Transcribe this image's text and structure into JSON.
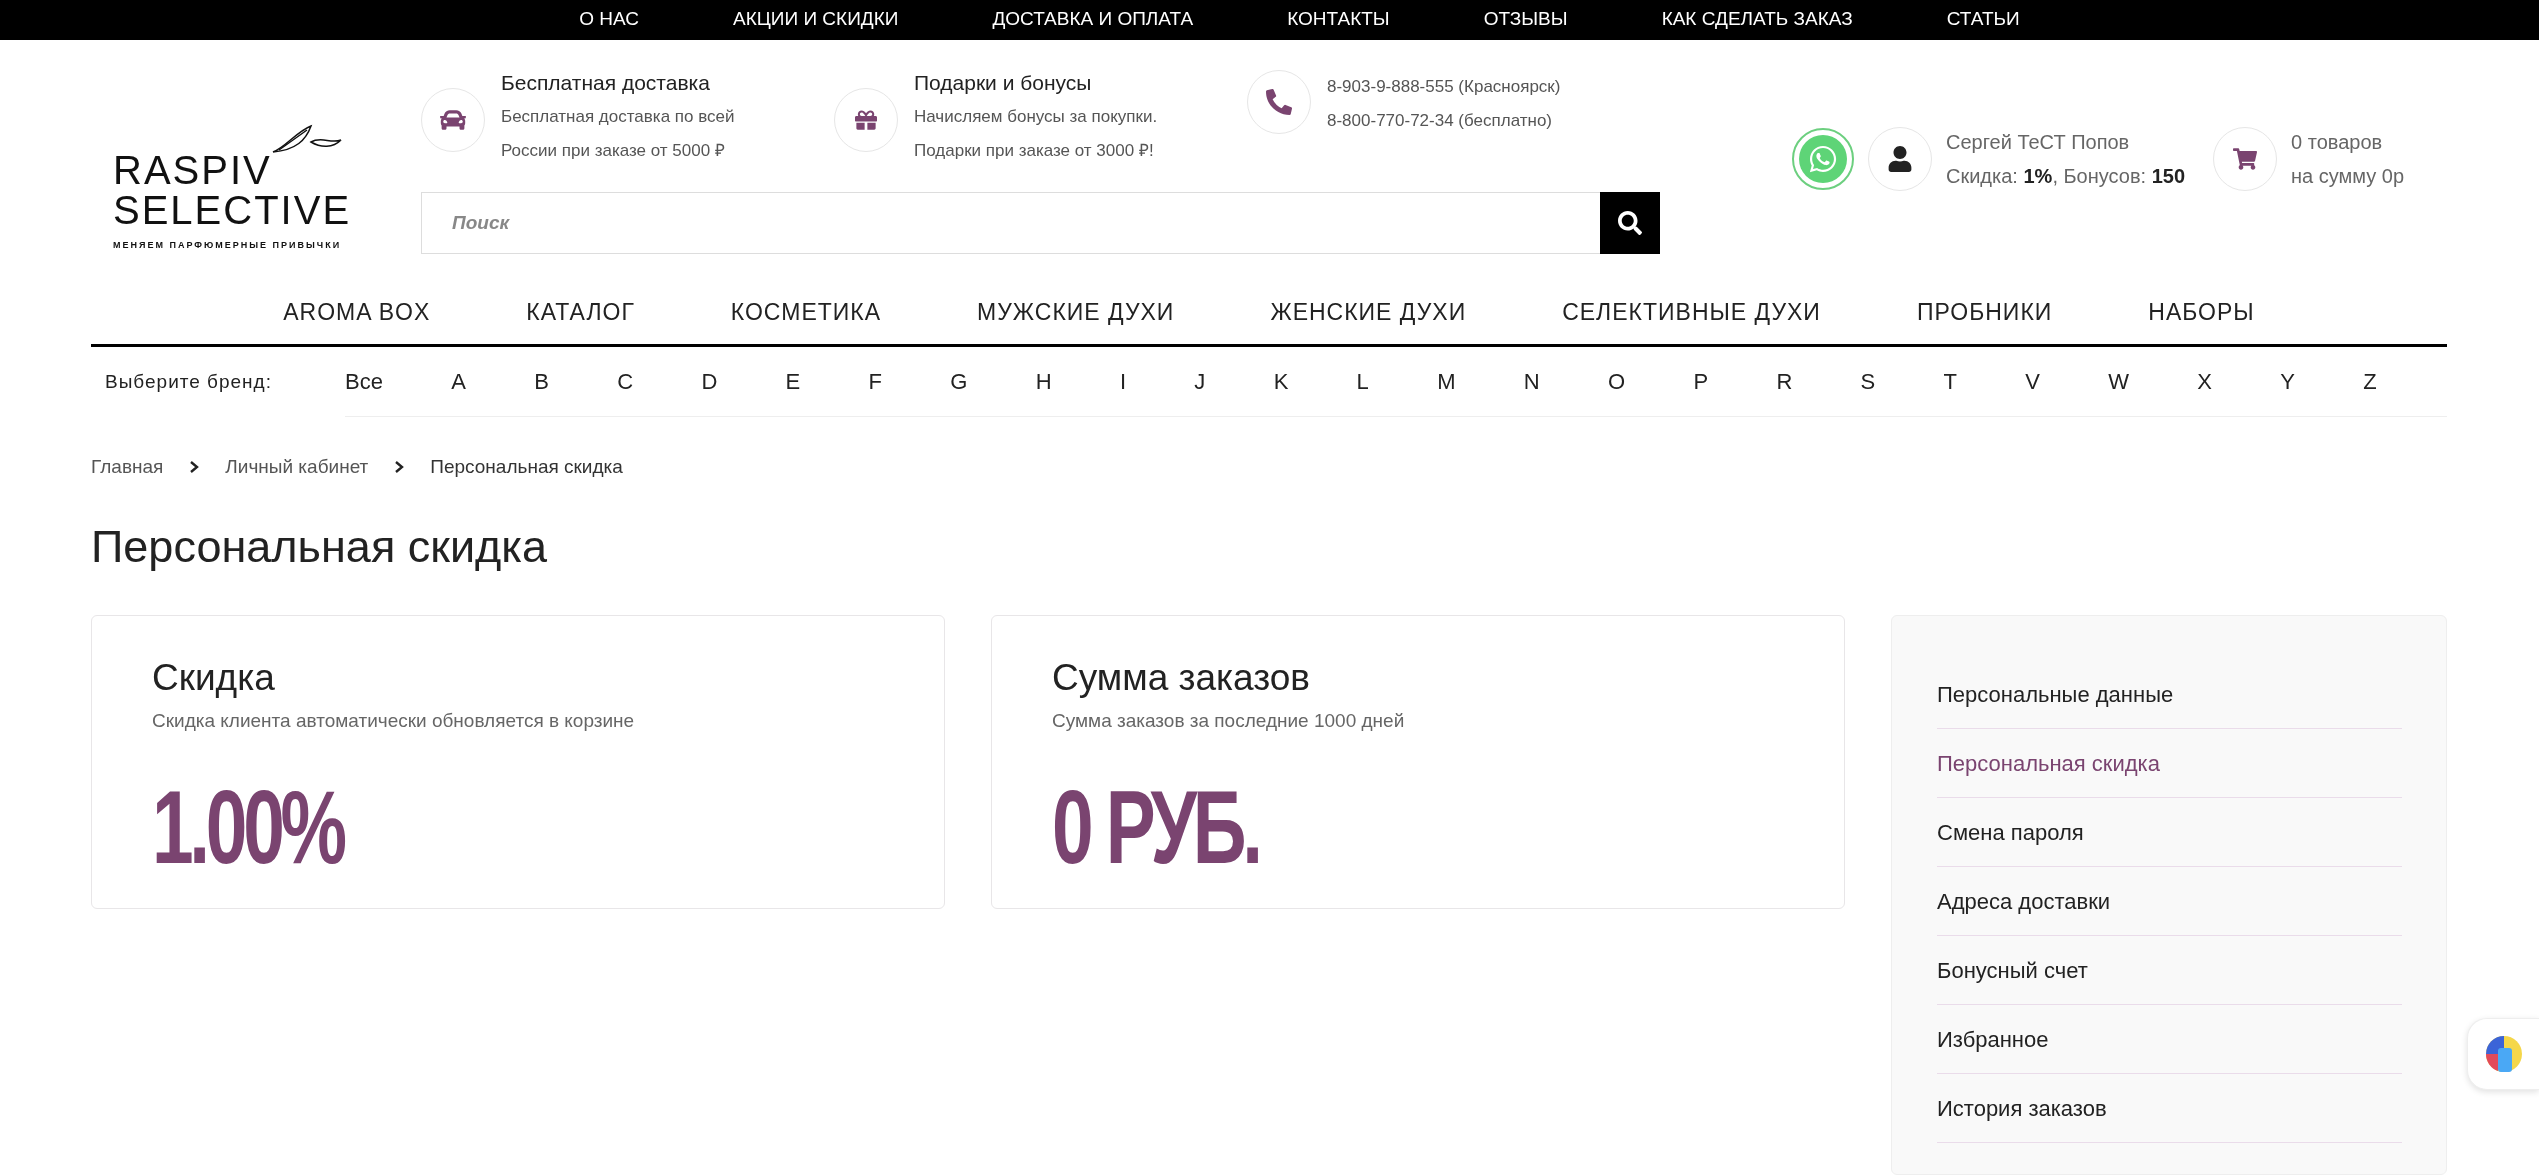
{
  "top_menu": [
    "О НАС",
    "АКЦИИ И СКИДКИ",
    "ДОСТАВКА И ОПЛАТА",
    "КОНТАКТЫ",
    "ОТЗЫВЫ",
    "КАК СДЕЛАТЬ ЗАКАЗ",
    "СТАТЬИ"
  ],
  "logo": {
    "line1": "RASPIV",
    "line2": "SELECTIVE",
    "tagline": "МЕНЯЕМ ПАРФЮМЕРНЫЕ ПРИВЫЧКИ"
  },
  "info_blocks": [
    {
      "kind": "delivery",
      "title": "Бесплатная доставка",
      "lines": [
        "Бесплатная доставка по всей",
        "России при заказе от 5000 ₽"
      ]
    },
    {
      "kind": "gift",
      "title": "Подарки и бонусы",
      "lines": [
        "Начисляем бонусы за покупки.",
        "Подарки при заказе от 3000 ₽!"
      ]
    },
    {
      "kind": "phone",
      "lines": [
        "8-903-9-888-555 (Красноярск)",
        "8-800-770-72-34 (бесплатно)"
      ]
    }
  ],
  "search": {
    "placeholder": "Поиск"
  },
  "user": {
    "name": "Сергей ТеСТ Попов",
    "status": "Скидка: **1%**, Бонусов: **150**"
  },
  "cart": {
    "lines": [
      "0 товаров",
      "на сумму 0р"
    ]
  },
  "main_nav": [
    "AROMA BOX",
    "КАТАЛОГ",
    "КОСМЕТИКА",
    "МУЖСКИЕ ДУХИ",
    "ЖЕНСКИЕ ДУХИ",
    "СЕЛЕКТИВНЫЕ ДУХИ",
    "ПРОБНИКИ",
    "НАБОРЫ"
  ],
  "brand_filter": {
    "label": "Выберите бренд:",
    "letters": [
      "Все",
      "A",
      "B",
      "C",
      "D",
      "E",
      "F",
      "G",
      "H",
      "I",
      "J",
      "K",
      "L",
      "M",
      "N",
      "O",
      "P",
      "R",
      "S",
      "T",
      "V",
      "W",
      "X",
      "Y",
      "Z"
    ]
  },
  "breadcrumbs": [
    "Главная",
    "Личный кабинет",
    "Персональная скидка"
  ],
  "page_title": "Персональная скидка",
  "cards": [
    {
      "title": "Скидка",
      "subtitle": "Скидка клиента автоматически обновляется в корзине",
      "value": "1.00%"
    },
    {
      "title": "Сумма заказов",
      "subtitle": "Сумма заказов за последние 1000 дней",
      "value": "0 РУБ."
    }
  ],
  "sidebar": [
    {
      "label": "Персональные данные",
      "selected": false
    },
    {
      "label": "Персональная скидка",
      "selected": true
    },
    {
      "label": "Смена пароля",
      "selected": false
    },
    {
      "label": "Адреса доставки",
      "selected": false
    },
    {
      "label": "Бонусный счет",
      "selected": false
    },
    {
      "label": "Избранное",
      "selected": false
    },
    {
      "label": "История заказов",
      "selected": false
    }
  ]
}
